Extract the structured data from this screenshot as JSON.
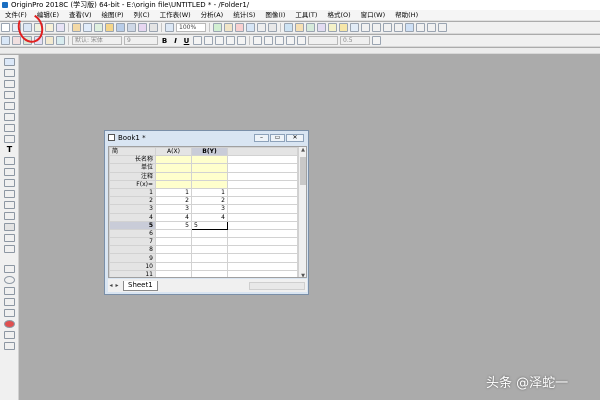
{
  "window": {
    "title": "OriginPro 2018C (学习版) 64-bit - E:\\origin file\\UNTITLED * - /Folder1/"
  },
  "menu": [
    "文件(F)",
    "编辑(E)",
    "查看(V)",
    "绘图(P)",
    "列(C)",
    "工作表(W)",
    "分析(A)",
    "统计(S)",
    "图像(I)",
    "工具(T)",
    "格式(O)",
    "窗口(W)",
    "帮助(H)"
  ],
  "toolbar": {
    "zoom": "100%",
    "font_combo": "默认: 宋体",
    "size_combo": "9",
    "line_width": "0.5",
    "bold_label": "B",
    "italic_label": "I",
    "underline_label": "U"
  },
  "left_tools": {
    "text_tool_label": "T"
  },
  "book": {
    "title": "Book1 *",
    "sheet_tab": "Sheet1",
    "header_corner": "简",
    "columns": [
      "A(X)",
      "B(Y)"
    ],
    "meta_rows": [
      "长名称",
      "单位",
      "注释",
      "F(x)="
    ],
    "rows": [
      {
        "num": "1",
        "a": "1",
        "b": "1"
      },
      {
        "num": "2",
        "a": "2",
        "b": "2"
      },
      {
        "num": "3",
        "a": "3",
        "b": "3"
      },
      {
        "num": "4",
        "a": "4",
        "b": "4"
      },
      {
        "num": "5",
        "a": "5",
        "b": "5"
      },
      {
        "num": "6",
        "a": "",
        "b": ""
      },
      {
        "num": "7",
        "a": "",
        "b": ""
      },
      {
        "num": "8",
        "a": "",
        "b": ""
      },
      {
        "num": "9",
        "a": "",
        "b": ""
      },
      {
        "num": "10",
        "a": "",
        "b": ""
      },
      {
        "num": "11",
        "a": "",
        "b": ""
      }
    ]
  },
  "watermark": "头条 @泽蛇一"
}
